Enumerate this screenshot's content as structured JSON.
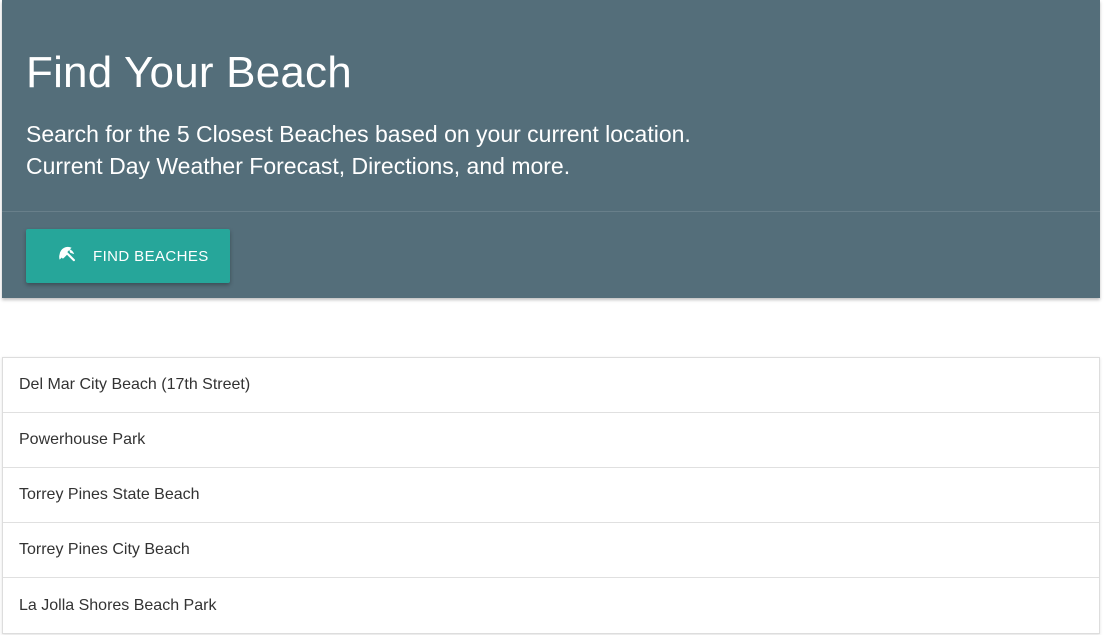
{
  "hero": {
    "title": "Find Your Beach",
    "subtitle_line1": "Search for the 5 Closest Beaches based on your current location.",
    "subtitle_line2": "Current Day Weather Forecast, Directions, and more.",
    "button": {
      "label": "FIND BEACHES",
      "icon": "beach-umbrella-icon"
    }
  },
  "beaches": [
    {
      "name": "Del Mar City Beach (17th Street)"
    },
    {
      "name": "Powerhouse Park"
    },
    {
      "name": "Torrey Pines State Beach"
    },
    {
      "name": "Torrey Pines City Beach"
    },
    {
      "name": "La Jolla Shores Beach Park"
    }
  ],
  "colors": {
    "hero_bg": "#546e7a",
    "button_bg": "#26a69a",
    "text_light": "#ffffff",
    "text_dark": "#333333"
  }
}
